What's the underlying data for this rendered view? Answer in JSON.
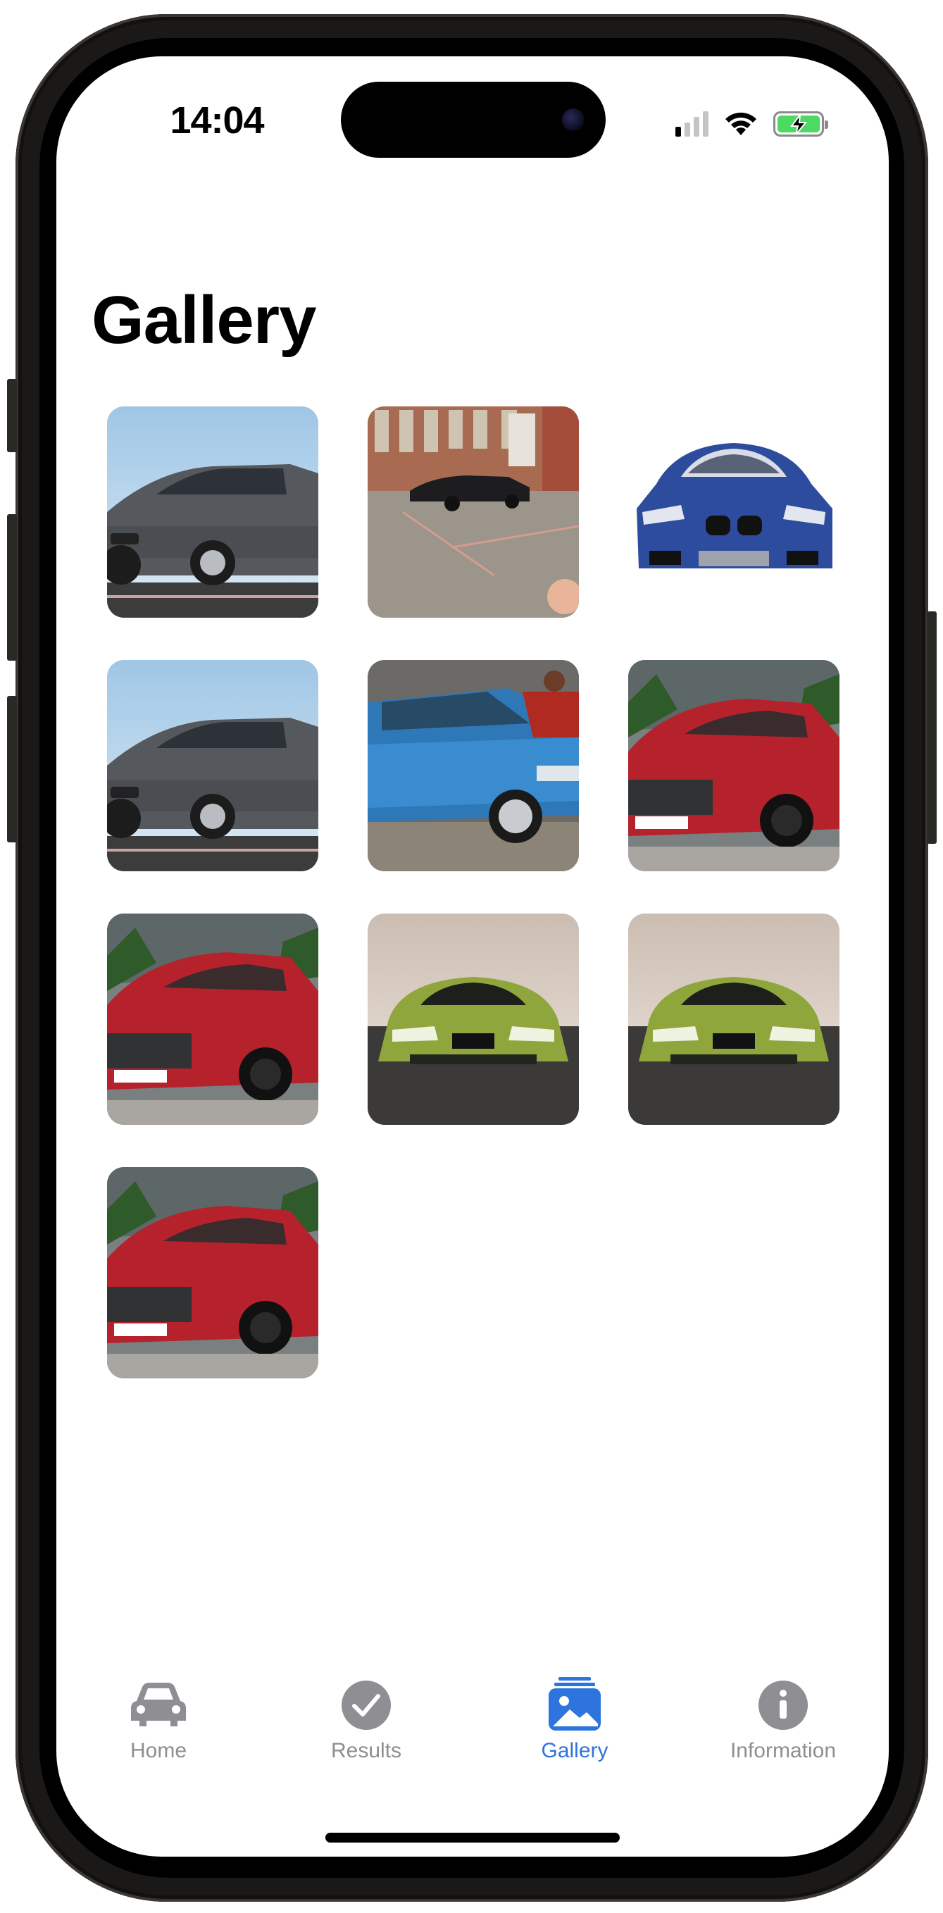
{
  "status_bar": {
    "time": "14:04",
    "icons": [
      "signal-icon",
      "wifi-icon",
      "battery-charging-icon"
    ]
  },
  "page": {
    "title": "Gallery"
  },
  "gallery": {
    "photos": [
      {
        "subject": "grey-bmw-hatchback"
      },
      {
        "subject": "black-sedan-parking-lot"
      },
      {
        "subject": "blue-bmw-cutout"
      },
      {
        "subject": "grey-bmw-hatchback"
      },
      {
        "subject": "blue-vw-up-with-person"
      },
      {
        "subject": "red-porsche-macan"
      },
      {
        "subject": "red-porsche-macan"
      },
      {
        "subject": "green-bmw-m4"
      },
      {
        "subject": "green-bmw-m4"
      },
      {
        "subject": "red-porsche-macan"
      }
    ]
  },
  "tab_bar": {
    "items": [
      {
        "label": "Home",
        "icon": "car-icon",
        "active": false
      },
      {
        "label": "Results",
        "icon": "checkmark-circle-icon",
        "active": false
      },
      {
        "label": "Gallery",
        "icon": "photo-stack-icon",
        "active": true
      },
      {
        "label": "Information",
        "icon": "info-circle-icon",
        "active": false
      }
    ]
  },
  "colors": {
    "accent": "#2d74de",
    "inactive": "#8e8e93"
  }
}
